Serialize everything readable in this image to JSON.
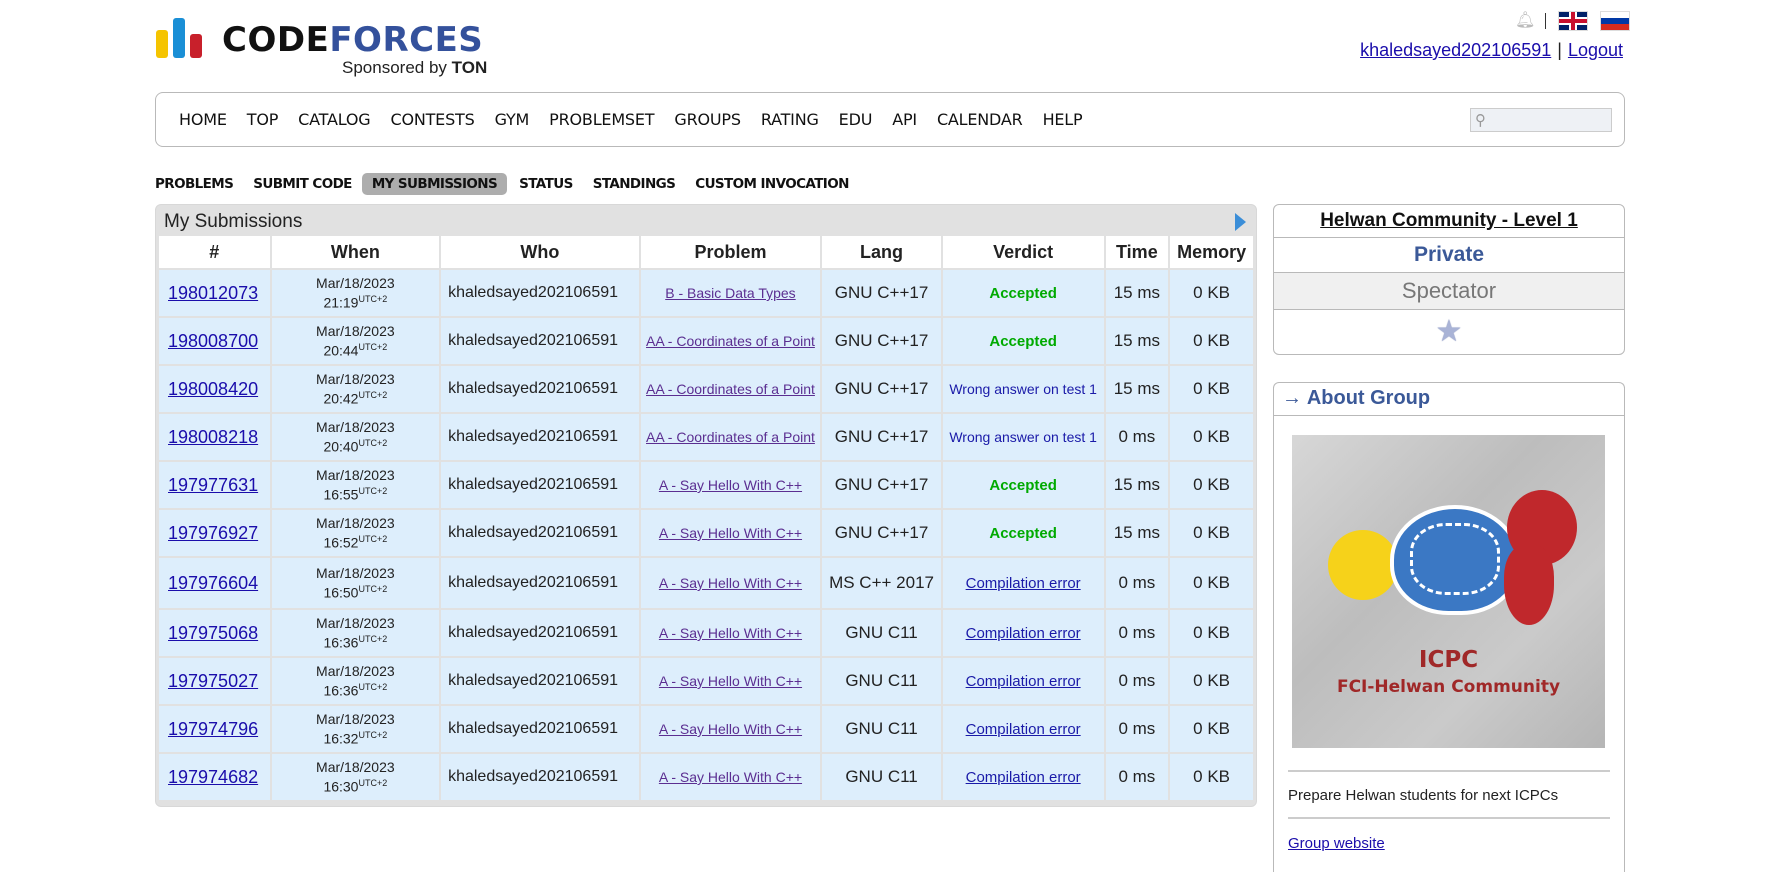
{
  "header": {
    "logo_text_code": "CODE",
    "logo_text_forces": "FORCES",
    "sponsor_prefix": "Sponsored by",
    "sponsor_name": "TON",
    "username": "khaledsayed202106591",
    "logout": "Logout",
    "separator": "|"
  },
  "main_nav": [
    "HOME",
    "TOP",
    "CATALOG",
    "CONTESTS",
    "GYM",
    "PROBLEMSET",
    "GROUPS",
    "RATING",
    "EDU",
    "API",
    "CALENDAR",
    "HELP"
  ],
  "second_menu": [
    "PROBLEMS",
    "SUBMIT CODE",
    "MY SUBMISSIONS",
    "STATUS",
    "STANDINGS",
    "CUSTOM INVOCATION"
  ],
  "submissions": {
    "title": "My Submissions",
    "columns": [
      "#",
      "When",
      "Who",
      "Problem",
      "Lang",
      "Verdict",
      "Time",
      "Memory"
    ],
    "rows": [
      {
        "id": "198012073",
        "date": "Mar/18/2023",
        "time": "21:19",
        "tz": "UTC+2",
        "who": "khaledsayed202106591",
        "problem": "B - Basic Data Types",
        "lang": "GNU C++17",
        "verdict": "Accepted",
        "exec_time": "15 ms",
        "memory": "0 KB"
      },
      {
        "id": "198008700",
        "date": "Mar/18/2023",
        "time": "20:44",
        "tz": "UTC+2",
        "who": "khaledsayed202106591",
        "problem": "AA - Coordinates of a Point",
        "lang": "GNU C++17",
        "verdict": "Accepted",
        "exec_time": "15 ms",
        "memory": "0 KB"
      },
      {
        "id": "198008420",
        "date": "Mar/18/2023",
        "time": "20:42",
        "tz": "UTC+2",
        "who": "khaledsayed202106591",
        "problem": "AA - Coordinates of a Point",
        "lang": "GNU C++17",
        "verdict": "Wrong answer on test 1",
        "exec_time": "15 ms",
        "memory": "0 KB"
      },
      {
        "id": "198008218",
        "date": "Mar/18/2023",
        "time": "20:40",
        "tz": "UTC+2",
        "who": "khaledsayed202106591",
        "problem": "AA - Coordinates of a Point",
        "lang": "GNU C++17",
        "verdict": "Wrong answer on test 1",
        "exec_time": "0 ms",
        "memory": "0 KB"
      },
      {
        "id": "197977631",
        "date": "Mar/18/2023",
        "time": "16:55",
        "tz": "UTC+2",
        "who": "khaledsayed202106591",
        "problem": "A - Say Hello With C++",
        "lang": "GNU C++17",
        "verdict": "Accepted",
        "exec_time": "15 ms",
        "memory": "0 KB"
      },
      {
        "id": "197976927",
        "date": "Mar/18/2023",
        "time": "16:52",
        "tz": "UTC+2",
        "who": "khaledsayed202106591",
        "problem": "A - Say Hello With C++",
        "lang": "GNU C++17",
        "verdict": "Accepted",
        "exec_time": "15 ms",
        "memory": "0 KB"
      },
      {
        "id": "197976604",
        "date": "Mar/18/2023",
        "time": "16:50",
        "tz": "UTC+2",
        "who": "khaledsayed202106591",
        "problem": "A - Say Hello With C++",
        "lang": "MS C++ 2017",
        "verdict": "Compilation error",
        "exec_time": "0 ms",
        "memory": "0 KB"
      },
      {
        "id": "197975068",
        "date": "Mar/18/2023",
        "time": "16:36",
        "tz": "UTC+2",
        "who": "khaledsayed202106591",
        "problem": "A - Say Hello With C++",
        "lang": "GNU C11",
        "verdict": "Compilation error",
        "exec_time": "0 ms",
        "memory": "0 KB"
      },
      {
        "id": "197975027",
        "date": "Mar/18/2023",
        "time": "16:36",
        "tz": "UTC+2",
        "who": "khaledsayed202106591",
        "problem": "A - Say Hello With C++",
        "lang": "GNU C11",
        "verdict": "Compilation error",
        "exec_time": "0 ms",
        "memory": "0 KB"
      },
      {
        "id": "197974796",
        "date": "Mar/18/2023",
        "time": "16:32",
        "tz": "UTC+2",
        "who": "khaledsayed202106591",
        "problem": "A - Say Hello With C++",
        "lang": "GNU C11",
        "verdict": "Compilation error",
        "exec_time": "0 ms",
        "memory": "0 KB"
      },
      {
        "id": "197974682",
        "date": "Mar/18/2023",
        "time": "16:30",
        "tz": "UTC+2",
        "who": "khaledsayed202106591",
        "problem": "A - Say Hello With C++",
        "lang": "GNU C11",
        "verdict": "Compilation error",
        "exec_time": "0 ms",
        "memory": "0 KB"
      }
    ]
  },
  "sidebar": {
    "group_name": "Helwan Community - Level 1",
    "group_type": "Private",
    "role": "Spectator",
    "about_title": "→ About Group",
    "image_text_line1": "ICPC",
    "image_text_line2": "FCI-Helwan Community",
    "description": "Prepare Helwan students for next ICPCs",
    "website_link": "Group website"
  },
  "colors": {
    "accent": "#3b5998",
    "accepted": "#00aa00",
    "row_bg": "#ddeefc"
  }
}
